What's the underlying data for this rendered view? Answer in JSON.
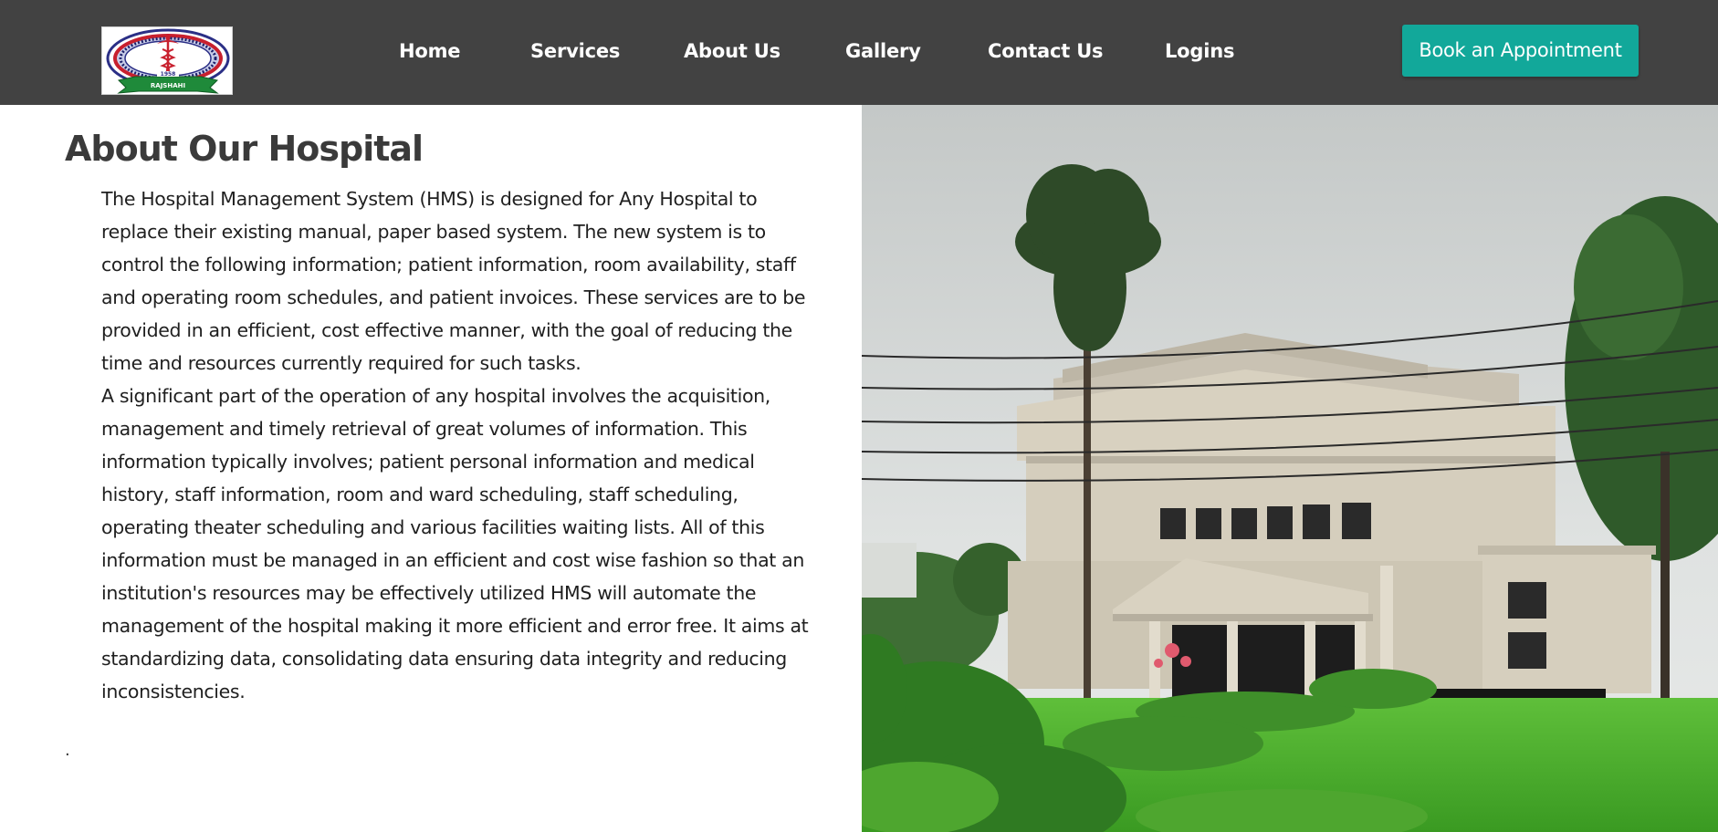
{
  "navbar": {
    "logo": {
      "icon": "caduceus-emblem-icon",
      "arc_text": "RAJSHAHI MEDICAL COLLEGE HOSPITAL",
      "year": "1958",
      "ribbon_text": "RAJSHAHI"
    },
    "links": [
      {
        "label": "Home"
      },
      {
        "label": "Services"
      },
      {
        "label": "About Us"
      },
      {
        "label": "Gallery"
      },
      {
        "label": "Contact Us"
      },
      {
        "label": "Logins"
      }
    ],
    "cta_label": "Book an Appointment"
  },
  "about": {
    "title": "About Our Hospital",
    "paragraphs": [
      "The Hospital Management System (HMS) is designed for Any Hospital to replace their existing manual, paper based system. The new system is to control the following information; patient information, room availability, staff and operating room schedules, and patient invoices. These services are to be provided in an efficient, cost effective manner, with the goal of reducing the time and resources currently required for such tasks.",
      "A significant part of the operation of any hospital involves the acquisition, management and timely retrieval of great volumes of information. This information typically involves; patient personal information and medical history, staff information, room and ward scheduling, staff scheduling, operating theater scheduling and various facilities waiting lists. All of this information must be managed in an efficient and cost wise fashion so that an institution's resources may be effectively utilized HMS will automate the management of the hospital making it more efficient and error free. It aims at standardizing data, consolidating data ensuring data integrity and reducing inconsistencies."
    ],
    "trailing_mark": "."
  },
  "hero": {
    "image": "hospital-building-photo"
  },
  "colors": {
    "navbar_bg": "#424242",
    "cta_bg": "#12a89a",
    "nav_text": "#ffffff",
    "title_text": "#3a3a3a"
  }
}
